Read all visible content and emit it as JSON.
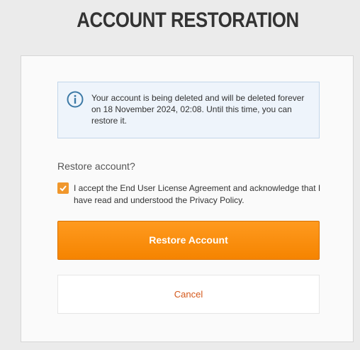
{
  "page": {
    "title": "ACCOUNT RESTORATION"
  },
  "info": {
    "icon": "info-icon",
    "message": "Your account is being deleted and will be deleted forever on 18 November 2024, 02:08. Until this time, you can restore it."
  },
  "form": {
    "question": "Restore account?",
    "consent": {
      "checked": true,
      "label": "I accept the End User License Agreement and acknowledge that I have read and understood the Privacy Policy."
    },
    "restore_label": "Restore Account",
    "cancel_label": "Cancel"
  },
  "colors": {
    "accent": "#f58400",
    "cancel_text": "#d4581a",
    "info_background": "#eef4fb",
    "info_icon": "#3d7aa6"
  }
}
